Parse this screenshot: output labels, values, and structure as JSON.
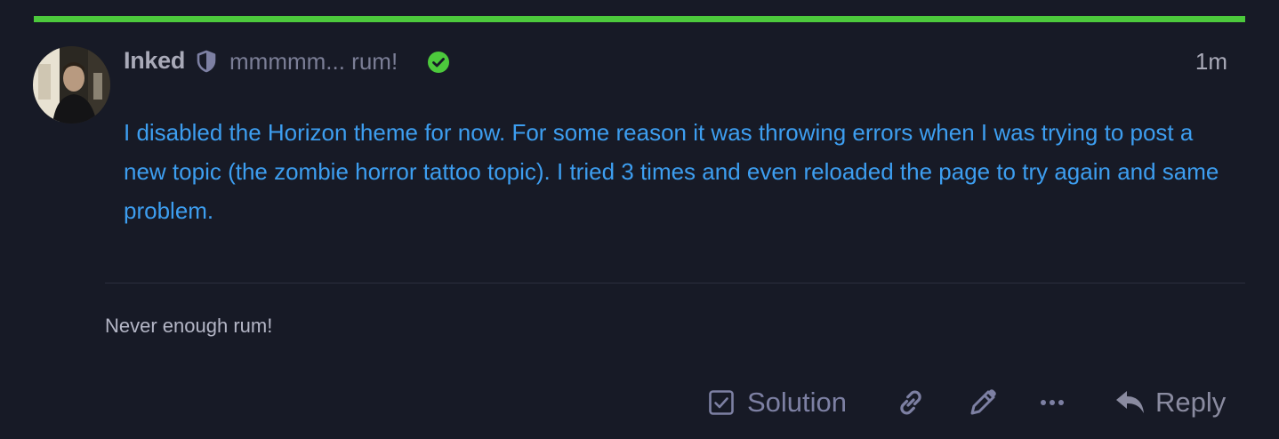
{
  "colors": {
    "background": "#171a26",
    "accent_bar": "#4cc93c",
    "link_text": "#3d9ef0",
    "verified": "#4cc93c",
    "action_icons": "#7d80a3"
  },
  "post": {
    "author": {
      "username": "Inked",
      "user_title": "mmmmm... rum!",
      "moderator_icon": "shield-icon",
      "verified_icon": "check-circle-icon"
    },
    "timestamp": "1m",
    "body": "I disabled the Horizon theme for now. For some reason it was throwing errors when I was trying to post a new topic (the zombie horror tattoo topic). I tried 3 times and even reloaded the page to try again and same problem.",
    "signature": "Never enough rum!"
  },
  "actions": {
    "solution_label": "Solution",
    "solution_icon": "checkbox-icon",
    "link_icon": "link-icon",
    "edit_icon": "pencil-icon",
    "more_icon": "ellipsis-icon",
    "reply_label": "Reply",
    "reply_icon": "reply-arrow-icon"
  }
}
